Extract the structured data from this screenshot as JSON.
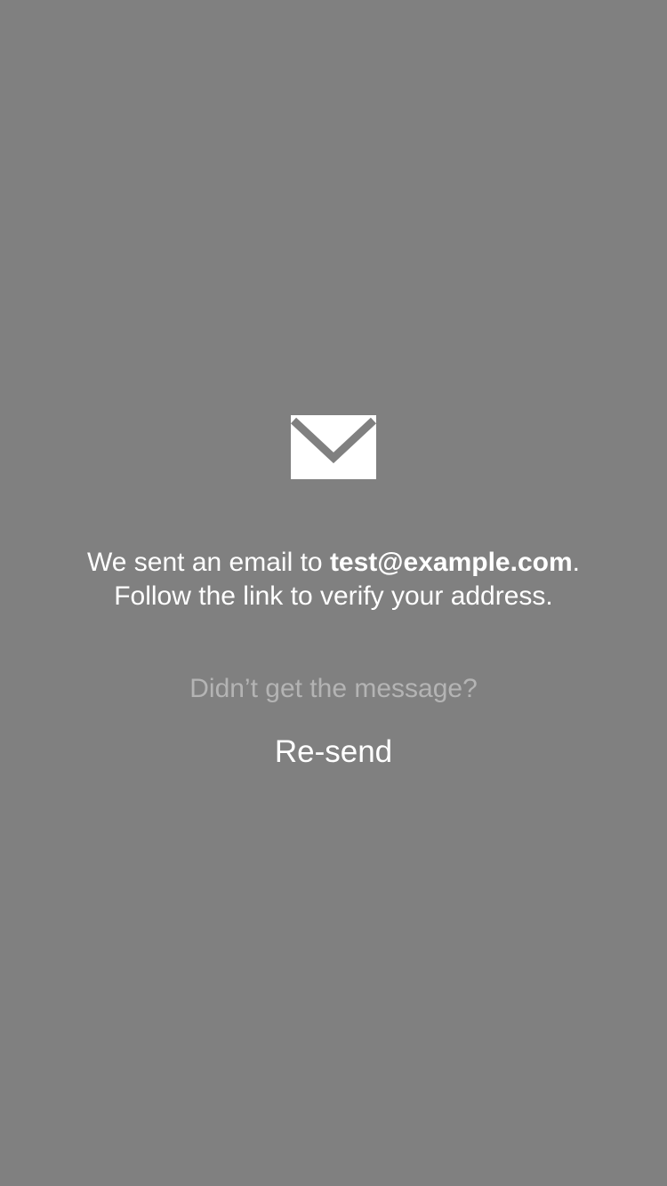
{
  "verification": {
    "message_prefix": "We sent an email to ",
    "email": "test@example.com",
    "message_suffix": ".",
    "message_line2": "Follow the link to verify your address.",
    "prompt": "Didn’t get the message?",
    "resend_label": "Re-send"
  },
  "icons": {
    "mail": "envelope-icon"
  },
  "colors": {
    "background": "#808080",
    "text": "#ffffff",
    "muted_text": "#b4b4b4"
  }
}
